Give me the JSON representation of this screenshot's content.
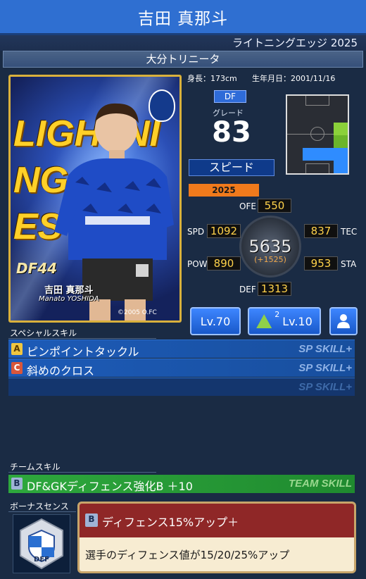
{
  "header": {
    "player_name": "吉田 真那斗",
    "card_series": "ライトニングエッジ 2025",
    "team": "大分トリニータ"
  },
  "card_art": {
    "headline": "LIGHTNING EDGES",
    "position_number": "DF44",
    "name_jp": "吉田 真那斗",
    "name_en": "Manato YOSHIDA",
    "copyright": "©2005 O.FC"
  },
  "profile": {
    "height": "身長：173cm",
    "birthdate": "生年月日：2001/11/16",
    "position": "DF",
    "grade_label": "グレード",
    "grade": "83",
    "type": "スピード"
  },
  "stats": {
    "year": "2025",
    "total": "5635",
    "bonus": "(+1525)",
    "ofe": {
      "label": "OFE",
      "value": "550"
    },
    "spd": {
      "label": "SPD",
      "value": "1092"
    },
    "tec": {
      "label": "TEC",
      "value": "837"
    },
    "pow": {
      "label": "POW",
      "value": "890"
    },
    "sta": {
      "label": "STA",
      "value": "953"
    },
    "def": {
      "label": "DEF",
      "value": "1313"
    }
  },
  "buttons": {
    "level": "Lv.70",
    "skill_level_plus": "2",
    "skill_level": "Lv.10"
  },
  "special_skill": {
    "section_label": "スペシャルスキル",
    "items": [
      {
        "grade": "A",
        "name": "ピンポイントタックル",
        "tag": "SP SKILL+"
      },
      {
        "grade": "C",
        "name": "斜めのクロス",
        "tag": "SP SKILL+"
      },
      {
        "grade": "",
        "name": "",
        "tag": "SP SKILL+"
      }
    ]
  },
  "team_skill": {
    "section_label": "チームスキル",
    "grade": "B",
    "name": "DF&GKディフェンス強化B ＋10",
    "tag": "TEAM SKILL"
  },
  "bonus_sense": {
    "section_label": "ボーナスセンス",
    "icon_label": "DEF",
    "grade": "B",
    "title": "ディフェンス15%アップ＋",
    "description": "選手のディフェンス値が15/20/25%アップ"
  },
  "colors": {
    "header_blue": "#2f6fd1",
    "background": "#1a2b44",
    "stat_yellow": "#ffd24a",
    "year_orange": "#f07a1c",
    "team_skill_green": "#2ea83d",
    "bonus_red": "#8f2727"
  }
}
